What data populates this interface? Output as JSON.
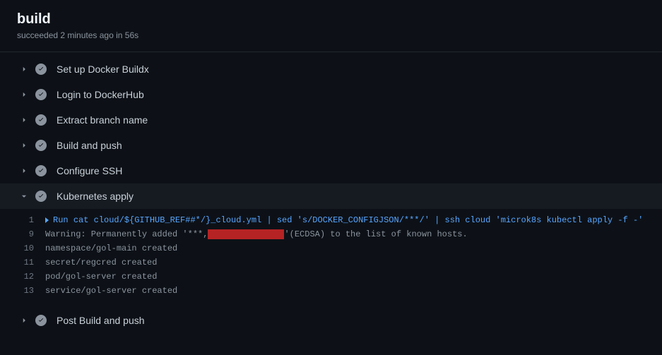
{
  "header": {
    "title": "build",
    "subtitle": "succeeded 2 minutes ago in 56s"
  },
  "steps": [
    {
      "label": "Set up Docker Buildx",
      "expanded": false
    },
    {
      "label": "Login to DockerHub",
      "expanded": false
    },
    {
      "label": "Extract branch name",
      "expanded": false
    },
    {
      "label": "Build and push",
      "expanded": false
    },
    {
      "label": "Configure SSH",
      "expanded": false
    },
    {
      "label": "Kubernetes apply",
      "expanded": true
    },
    {
      "label": "Post Build and push",
      "expanded": false
    }
  ],
  "log": {
    "lines": [
      {
        "n": "1",
        "prefix": "Run ",
        "content": "cat cloud/${GITHUB_REF##*/}_cloud.yml | sed 's/DOCKER_CONFIGJSON/***/' | ssh cloud 'microk8s kubectl apply -f -'",
        "command": true
      },
      {
        "n": "9",
        "content_before": "Warning: Permanently added '***,",
        "redacted": true,
        "content_after": "'(ECDSA) to the list of known hosts."
      },
      {
        "n": "10",
        "content": "namespace/gol-main created"
      },
      {
        "n": "11",
        "content": "secret/regcred created"
      },
      {
        "n": "12",
        "content": "pod/gol-server created"
      },
      {
        "n": "13",
        "content": "service/gol-server created"
      }
    ]
  }
}
